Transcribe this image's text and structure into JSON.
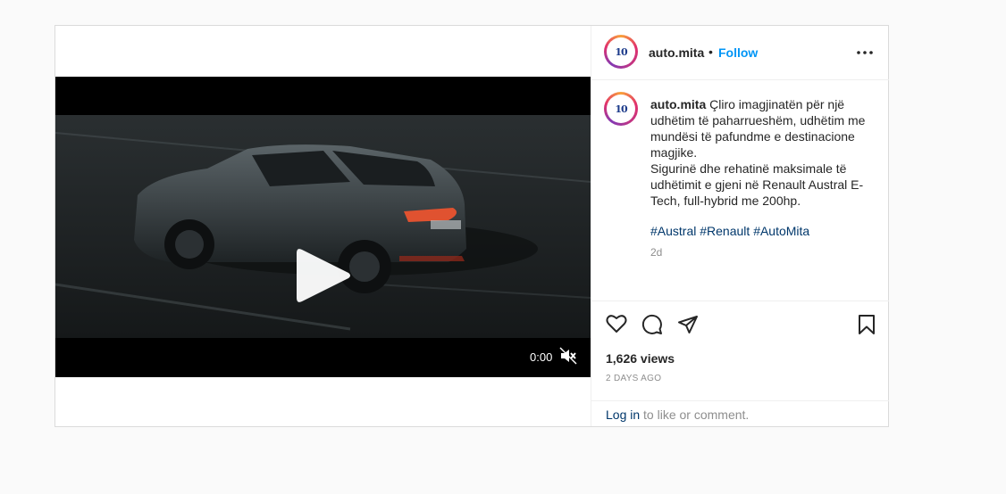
{
  "post": {
    "video": {
      "time": "0:00",
      "muted": true
    },
    "header": {
      "avatar_text": "10",
      "username": "auto.mita",
      "separator": "•",
      "follow_label": "Follow"
    },
    "caption": {
      "username": "auto.mita",
      "text_line1": "Çliro imagjinatën për një udhëtim të paharrueshëm, udhëtim me mundësi të pafundme e destinacione magjike.",
      "text_line2": "Sigurinë dhe rehatinë maksimale të udhëtimit e gjeni në Renault Austral E-Tech, full-hybrid me 200hp.",
      "hashtags": [
        "#Austral",
        "#Renault",
        "#AutoMita"
      ],
      "time_ago": "2d"
    },
    "stats": {
      "views": "1,626 views",
      "date": "2 DAYS AGO"
    },
    "login": {
      "link": "Log in",
      "rest": " to like or comment."
    }
  },
  "colors": {
    "accent": "#0095f6",
    "link": "#00376b",
    "muted": "#8e8e8e"
  },
  "icons": [
    "more-icon",
    "play-icon",
    "mute-icon",
    "heart-icon",
    "comment-icon",
    "share-icon",
    "bookmark-icon"
  ]
}
